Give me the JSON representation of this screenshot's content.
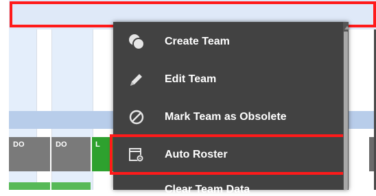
{
  "roster": {
    "cells": [
      "DO",
      "DO",
      "L"
    ]
  },
  "menu": {
    "items": [
      {
        "label": "Create Team",
        "icon": "create-team-icon"
      },
      {
        "label": "Edit Team",
        "icon": "pencil-icon"
      },
      {
        "label": "Mark Team as Obsolete",
        "icon": "obsolete-icon"
      },
      {
        "label": "Auto Roster",
        "icon": "auto-roster-icon"
      }
    ],
    "partial_item_label": "Clear Team Data"
  },
  "colors": {
    "menu_background": "#424242",
    "highlight": "#ff1a1a",
    "roster_green": "#2ea12e",
    "roster_dark": "#7a7a7a"
  }
}
